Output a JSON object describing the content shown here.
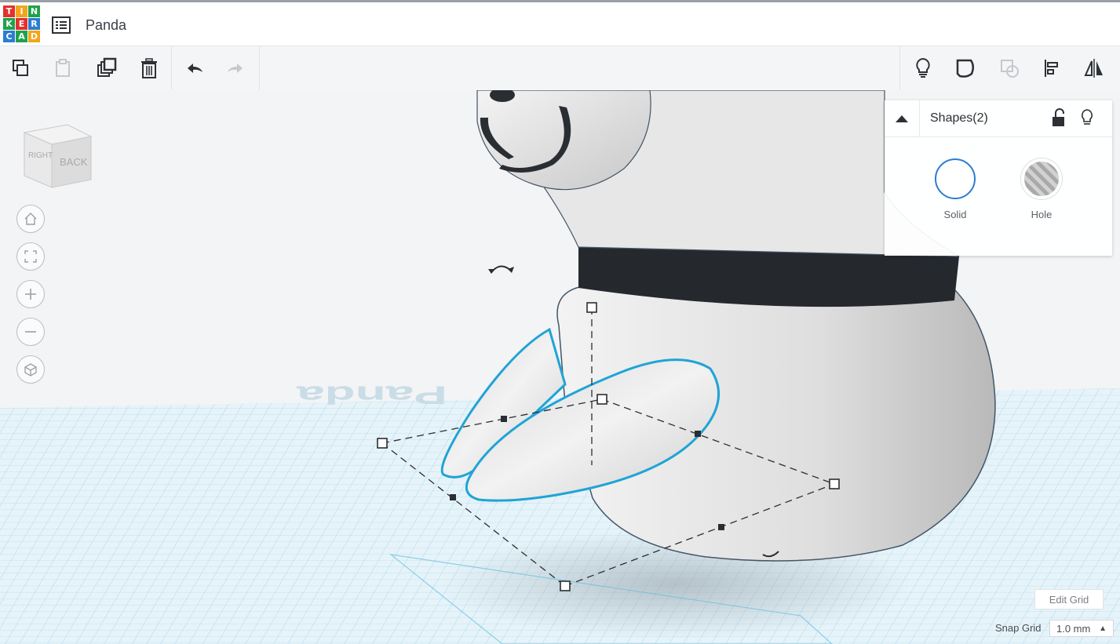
{
  "app": {
    "logo_letters": [
      "T",
      "I",
      "N",
      "K",
      "E",
      "R",
      "C",
      "A",
      "D"
    ],
    "logo_colors": [
      "#e2312e",
      "#f3a51b",
      "#1ea34a",
      "#1ea34a",
      "#e2312e",
      "#2b7dd1",
      "#2b7dd1",
      "#1ea34a",
      "#f3a51b"
    ],
    "title": "Panda"
  },
  "toolbar": {
    "left": [
      {
        "name": "copy-button",
        "icon": "copy-icon"
      },
      {
        "name": "paste-button",
        "icon": "paste-icon",
        "disabled": true
      },
      {
        "name": "duplicate-button",
        "icon": "duplicate-icon"
      },
      {
        "name": "delete-button",
        "icon": "trash-icon"
      },
      {
        "name": "undo-button",
        "icon": "undo-icon"
      },
      {
        "name": "redo-button",
        "icon": "redo-icon",
        "disabled": true
      }
    ],
    "right": [
      {
        "name": "show-all-button",
        "icon": "lightbulb-icon"
      },
      {
        "name": "group-button",
        "icon": "group-icon"
      },
      {
        "name": "ungroup-button",
        "icon": "ungroup-icon",
        "disabled": true
      },
      {
        "name": "align-button",
        "icon": "align-icon"
      },
      {
        "name": "mirror-button",
        "icon": "mirror-icon"
      }
    ]
  },
  "view": {
    "cube_faces": [
      "RIGHT",
      "BACK"
    ],
    "nav_buttons": [
      "home-icon",
      "fit-view-icon",
      "zoom-in-icon",
      "zoom-out-icon",
      "perspective-icon"
    ]
  },
  "inspector": {
    "title": "Shapes(2)",
    "solid_label": "Solid",
    "hole_label": "Hole"
  },
  "grid": {
    "edit_label": "Edit Grid",
    "snap_label": "Snap Grid",
    "snap_value": "1.0 mm",
    "watermark": "Panda"
  },
  "colors": {
    "accent": "#1fa4d6",
    "band": "#25292e",
    "grid_line": "#7ec3e0"
  }
}
